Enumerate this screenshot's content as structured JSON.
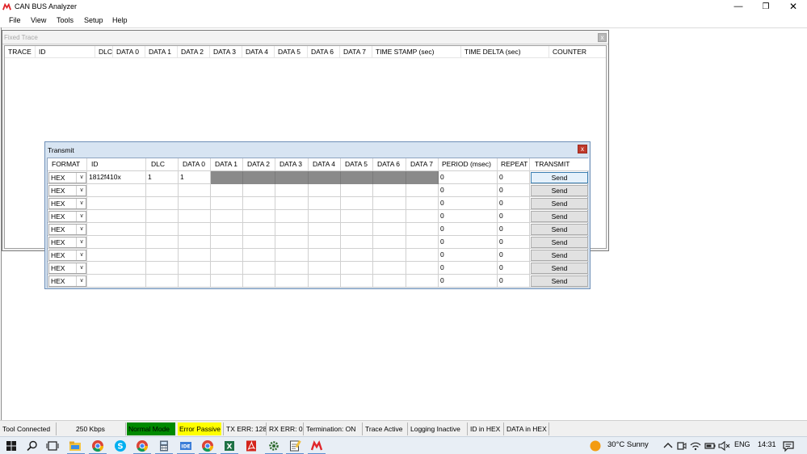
{
  "app": {
    "title": "CAN BUS Analyzer"
  },
  "window_controls": {
    "minimize": "—",
    "maximize": "❐",
    "close": "✕"
  },
  "menu": [
    "File",
    "View",
    "Tools",
    "Setup",
    "Help"
  ],
  "fixed_trace": {
    "title": "Fixed Trace",
    "close": "x",
    "columns": [
      "TRACE",
      "ID",
      "DLC",
      "DATA 0",
      "DATA 1",
      "DATA 2",
      "DATA 3",
      "DATA 4",
      "DATA 5",
      "DATA 6",
      "DATA 7",
      "TIME STAMP (sec)",
      "TIME DELTA (sec)",
      "COUNTER"
    ]
  },
  "transmit": {
    "title": "Transmit",
    "close": "x",
    "columns": [
      "FORMAT",
      "ID",
      "DLC",
      "DATA 0",
      "DATA 1",
      "DATA 2",
      "DATA 3",
      "DATA 4",
      "DATA 5",
      "DATA 6",
      "DATA 7",
      "PERIOD (msec)",
      "REPEAT",
      "TRANSMIT"
    ],
    "rows": [
      {
        "format": "HEX",
        "id": "1812f410x",
        "dlc": "1",
        "data0": "1",
        "period": "0",
        "repeat": "0",
        "send": "Send"
      },
      {
        "format": "HEX",
        "id": "",
        "dlc": "",
        "data0": "",
        "period": "0",
        "repeat": "0",
        "send": "Send"
      },
      {
        "format": "HEX",
        "id": "",
        "dlc": "",
        "data0": "",
        "period": "0",
        "repeat": "0",
        "send": "Send"
      },
      {
        "format": "HEX",
        "id": "",
        "dlc": "",
        "data0": "",
        "period": "0",
        "repeat": "0",
        "send": "Send"
      },
      {
        "format": "HEX",
        "id": "",
        "dlc": "",
        "data0": "",
        "period": "0",
        "repeat": "0",
        "send": "Send"
      },
      {
        "format": "HEX",
        "id": "",
        "dlc": "",
        "data0": "",
        "period": "0",
        "repeat": "0",
        "send": "Send"
      },
      {
        "format": "HEX",
        "id": "",
        "dlc": "",
        "data0": "",
        "period": "0",
        "repeat": "0",
        "send": "Send"
      },
      {
        "format": "HEX",
        "id": "",
        "dlc": "",
        "data0": "",
        "period": "0",
        "repeat": "0",
        "send": "Send"
      },
      {
        "format": "HEX",
        "id": "",
        "dlc": "",
        "data0": "",
        "period": "0",
        "repeat": "0",
        "send": "Send"
      }
    ]
  },
  "status": {
    "tool": "Tool Connected",
    "baud": "250 Kbps",
    "mode": "Normal Mode",
    "error_state": "Error Passive",
    "tx_err": "TX ERR: 128",
    "rx_err": "RX ERR: 0",
    "termination": "Termination: ON",
    "trace": "Trace Active",
    "logging": "Logging Inactive",
    "id_fmt": "ID in HEX",
    "data_fmt": "DATA in HEX",
    "colors": {
      "mode_bg": "#008a00",
      "error_bg": "#ffff00"
    }
  },
  "taskbar": {
    "icons": [
      "windows-icon",
      "search-icon",
      "task-view-icon",
      "file-explorer-icon",
      "chrome-icon",
      "skype-icon",
      "chrome-icon",
      "calculator-icon",
      "ide-icon",
      "chrome-icon",
      "excel-icon",
      "pdf-icon",
      "settings-icon",
      "notepad-icon",
      "microchip-icon"
    ],
    "weather": "30°C  Sunny",
    "language": "ENG",
    "time": "14:31"
  }
}
